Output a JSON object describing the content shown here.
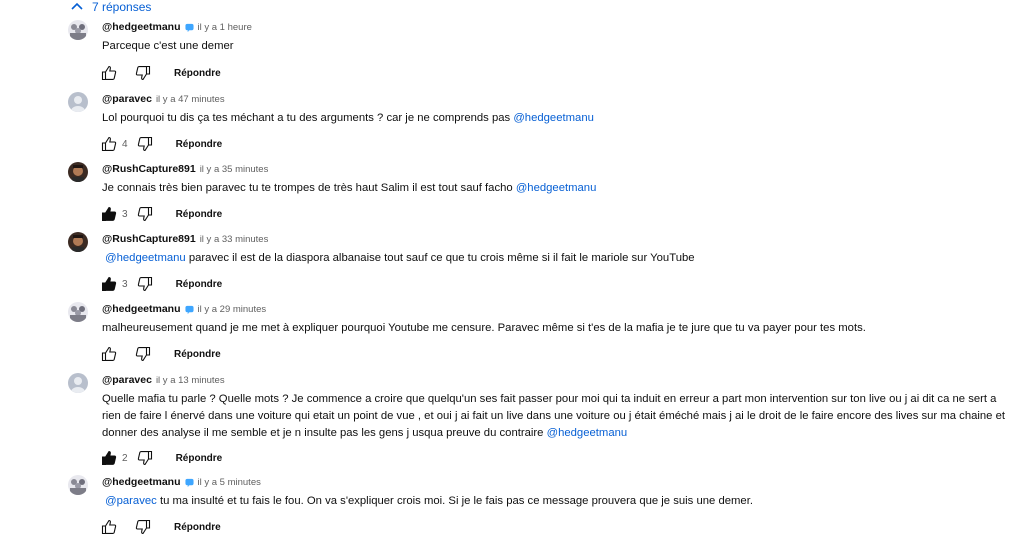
{
  "replies_toggle": {
    "label": "7 réponses",
    "icon": "chevron-up-icon"
  },
  "colors": {
    "accent": "#065fd4",
    "text": "#0f0f0f",
    "muted": "#606060"
  },
  "comments": [
    {
      "author": "@hedgeetmanu",
      "verified": true,
      "time": "il y a 1 heure",
      "text": "Parceque c'est une demer",
      "likes": "",
      "liked": false,
      "reply_label": "Répondre",
      "avatar": "group-avatar"
    },
    {
      "author": "@paravec",
      "verified": false,
      "time": "il y a 47 minutes",
      "text": "Lol pourquoi tu dis ça tes méchant a tu des arguments ? car je ne comprends pas ",
      "mention": "@hedgeetmanu",
      "likes": "4",
      "liked": false,
      "reply_label": "Répondre",
      "avatar": "default-avatar"
    },
    {
      "author": "@RushCapture891",
      "verified": false,
      "time": "il y a 35 minutes",
      "text": "Je connais très bien paravec  tu te trompes de très haut Salim il est tout sauf facho ",
      "mention": "@hedgeetmanu",
      "likes": "3",
      "liked": true,
      "reply_label": "Répondre",
      "avatar": "face-avatar"
    },
    {
      "author": "@RushCapture891",
      "verified": false,
      "time": "il y a 33 minutes",
      "mention_first": "@hedgeetmanu",
      "text": " paravec il est de la diaspora albanaise tout sauf ce que tu crois même si il fait le mariole sur YouTube",
      "likes": "3",
      "liked": true,
      "reply_label": "Répondre",
      "avatar": "face-avatar"
    },
    {
      "author": "@hedgeetmanu",
      "verified": true,
      "time": "il y a 29 minutes",
      "text": "malheureusement quand je me met à expliquer pourquoi Youtube me censure. Paravec même si t'es de la mafia je te jure que tu va payer pour tes mots.",
      "likes": "",
      "liked": false,
      "reply_label": "Répondre",
      "avatar": "group-avatar"
    },
    {
      "author": "@paravec",
      "verified": false,
      "time": "il y a 13 minutes",
      "text": "Quelle mafia tu parle ? Quelle mots ? Je commence a croire que quelqu'un ses fait passer pour moi qui ta induit en erreur a part  mon intervention sur ton live ou j ai dit ca ne sert a rien de faire l énervé dans une voiture  qui etait un point de vue , et oui j ai fait un live dans une voiture ou j était éméché mais j ai le droit de le faire encore des lives sur ma chaine et donner des analyse il me semble et je n insulte pas les gens j usqua preuve du contraire ",
      "mention": "@hedgeetmanu",
      "likes": "2",
      "liked": true,
      "reply_label": "Répondre",
      "avatar": "default-avatar"
    },
    {
      "author": "@hedgeetmanu",
      "verified": true,
      "time": "il y a 5 minutes",
      "mention_first": "@paravec",
      "text": "  tu ma insulté et tu fais le fou. On va s'expliquer crois moi. Si je le fais pas ce message prouvera que je suis une demer.",
      "likes": "",
      "liked": false,
      "reply_label": "Répondre",
      "avatar": "group-avatar"
    }
  ]
}
